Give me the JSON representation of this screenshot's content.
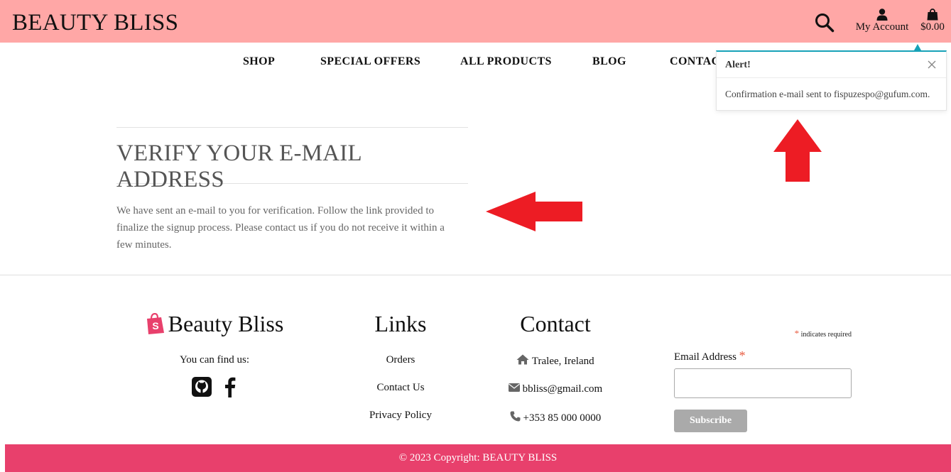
{
  "header": {
    "brand": "BEAUTY BLISS",
    "search_icon": "search-icon",
    "account_label": "My Account",
    "bag_total": "$0.00"
  },
  "nav": {
    "items": [
      "SHOP",
      "SPECIAL OFFERS",
      "ALL PRODUCTS",
      "BLOG",
      "CONTACT"
    ]
  },
  "alert": {
    "title": "Alert!",
    "message": "Confirmation e-mail sent to fispuzespo@gufum.com.",
    "accent_color": "#17a2b8"
  },
  "verify": {
    "title": "VERIFY YOUR E-MAIL ADDRESS",
    "line1": "We have sent an e-mail to you for verification. Follow the link provided to",
    "line2": "finalize the signup process. Please contact us if you do not receive it within a",
    "line3": "few minutes."
  },
  "annotation_arrow_color": "#ed1c24",
  "footer": {
    "brand": {
      "title": "Beauty Bliss",
      "subtitle": "You can find us:",
      "icons": [
        "shopify-bag-icon",
        "github-icon",
        "facebook-icon"
      ]
    },
    "links": {
      "title": "Links",
      "items": [
        "Orders",
        "Contact Us",
        "Privacy Policy"
      ]
    },
    "contact": {
      "title": "Contact",
      "address": "Tralee, Ireland",
      "email": "bbliss@gmail.com",
      "phone": "+353 85 000 0000"
    },
    "signup": {
      "required_note": "indicates required",
      "star": "*",
      "email_label": "Email Address",
      "email_value": "",
      "subscribe_label": "Subscribe"
    },
    "copyright": "© 2023 Copyright: BEAUTY BLISS"
  },
  "colors": {
    "header_bg": "#ffa7a6",
    "footer_bar": "#e8406c"
  }
}
